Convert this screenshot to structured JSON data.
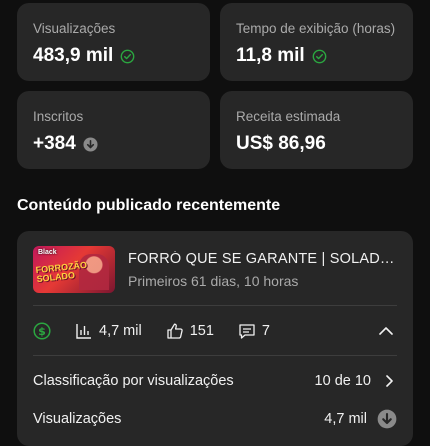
{
  "metrics": [
    {
      "label": "Visualizações",
      "value": "483,9 mil",
      "icon": "check-circle-icon"
    },
    {
      "label": "Tempo de exibição (horas)",
      "value": "11,8 mil",
      "icon": "check-circle-icon"
    },
    {
      "label": "Inscritos",
      "value": "+384",
      "icon": "arrow-down-circle-icon"
    },
    {
      "label": "Receita estimada",
      "value": "US$ 86,96"
    }
  ],
  "colors": {
    "background": "#0f0f0f",
    "card": "#272727",
    "check_green": "#2ba640",
    "muted_text": "#aaaaaa"
  },
  "recent": {
    "section_title": "Conteúdo publicado recentemente",
    "video": {
      "thumbnail_logo": "Black",
      "thumbnail_text": "FORROZÃO SOLADO",
      "title": "FORRÓ QUE SE GARANTE | SOLADO...",
      "subtitle": "Primeiros 61 dias, 10 horas"
    },
    "stats": {
      "views": "4,7 mil",
      "likes": "151",
      "comments": "7"
    },
    "details": [
      {
        "label": "Classificação por visualizações",
        "value": "10 de 10",
        "icon": "chevron-right-icon"
      },
      {
        "label": "Visualizações",
        "value": "4,7 mil",
        "icon": "arrow-down-circle-icon"
      }
    ]
  }
}
